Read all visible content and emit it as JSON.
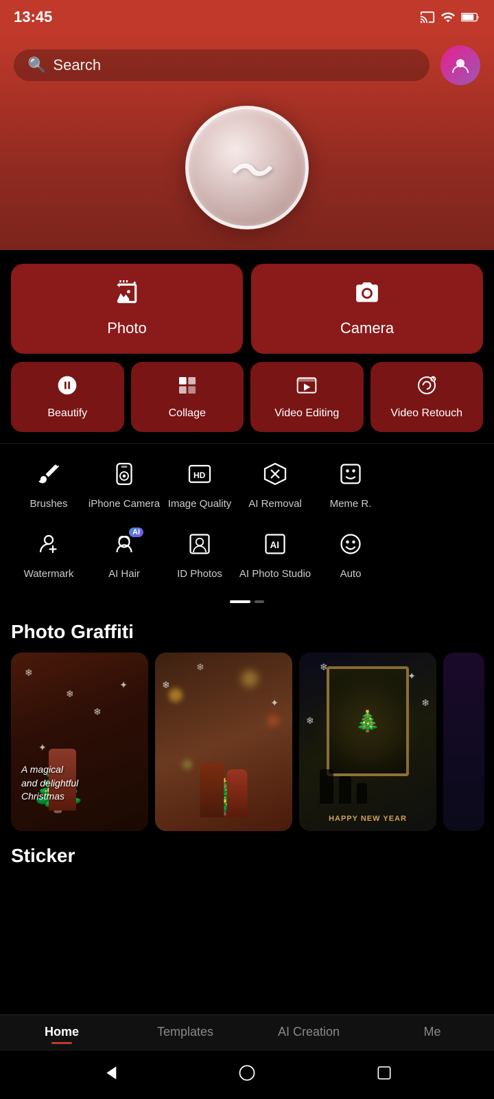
{
  "statusBar": {
    "time": "13:45",
    "icons": [
      "cast",
      "wifi",
      "battery"
    ]
  },
  "header": {
    "searchPlaceholder": "Search",
    "avatarLabel": "profile"
  },
  "logo": {
    "symbol": "∿"
  },
  "mainButtons": [
    {
      "id": "photo",
      "label": "Photo",
      "icon": "✦"
    },
    {
      "id": "camera",
      "label": "Camera",
      "icon": "⊙"
    }
  ],
  "secondaryButtons": [
    {
      "id": "beautify",
      "label": "Beautify",
      "icon": "♻"
    },
    {
      "id": "collage",
      "label": "Collage",
      "icon": "▣"
    },
    {
      "id": "video-editing",
      "label": "Video\nEditing",
      "icon": "▶"
    },
    {
      "id": "video-retouch",
      "label": "Video\nRetouch",
      "icon": "♻"
    }
  ],
  "tools": {
    "row1": [
      {
        "id": "brushes",
        "label": "Brushes",
        "icon": "🖌"
      },
      {
        "id": "iphone-camera",
        "label": "iPhone Camera",
        "icon": "📷"
      },
      {
        "id": "image-quality",
        "label": "Image Quality",
        "icon": "HD"
      },
      {
        "id": "ai-removal",
        "label": "AI Removal",
        "icon": "⬡"
      },
      {
        "id": "meme",
        "label": "Meme R.",
        "icon": "⊡"
      }
    ],
    "row2": [
      {
        "id": "watermark",
        "label": "Watermark",
        "icon": "👤"
      },
      {
        "id": "ai-hair",
        "label": "AI Hair",
        "icon": "👤",
        "badge": "AI"
      },
      {
        "id": "id-photos",
        "label": "ID Photos",
        "icon": "👤"
      },
      {
        "id": "ai-photo-studio",
        "label": "AI Photo Studio",
        "icon": "🅐"
      },
      {
        "id": "auto",
        "label": "Auto",
        "icon": "😊"
      }
    ]
  },
  "scrollIndicator": {
    "dots": [
      "active",
      "inactive"
    ]
  },
  "photoGraffiti": {
    "title": "Photo Graffiti",
    "photos": [
      {
        "id": "photo1",
        "theme": "christmas-girl",
        "text": "A magical\nand delightful\nChristmas"
      },
      {
        "id": "photo2",
        "theme": "christmas-couple",
        "text": ""
      },
      {
        "id": "photo3",
        "theme": "christmas-window",
        "text": "HAPPY NEW YEAR"
      }
    ]
  },
  "sticker": {
    "title": "Sticker"
  },
  "bottomNav": {
    "tabs": [
      {
        "id": "home",
        "label": "Home",
        "active": true
      },
      {
        "id": "templates",
        "label": "Templates",
        "active": false
      },
      {
        "id": "ai-creation",
        "label": "AI Creation",
        "active": false
      },
      {
        "id": "me",
        "label": "Me",
        "active": false
      }
    ]
  }
}
